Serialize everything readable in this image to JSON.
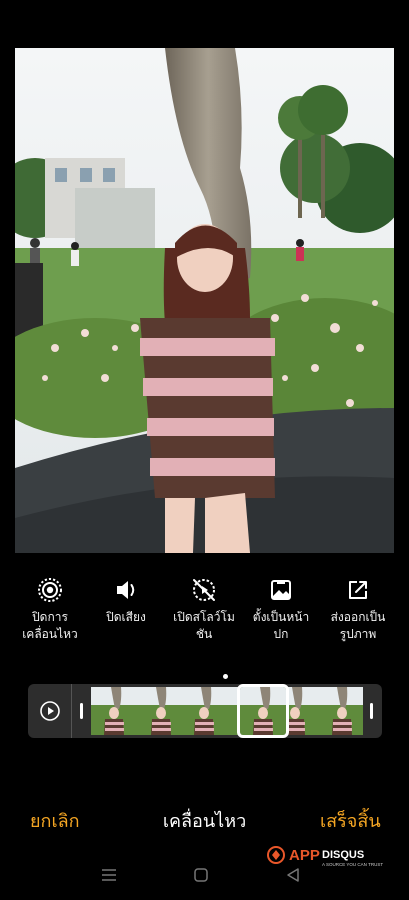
{
  "toolbar": {
    "items": [
      {
        "label": "ปิดการ\nเคลื่อนไหว",
        "icon": "motion-photo-icon"
      },
      {
        "label": "ปิดเสียง",
        "icon": "speaker-icon"
      },
      {
        "label": "เปิดสโลว์โม\nชัน",
        "icon": "slow-motion-off-icon"
      },
      {
        "label": "ตั้งเป็นหน้า\nปก",
        "icon": "cover-image-icon"
      },
      {
        "label": "ส่งออกเป็น\nรูปภาพ",
        "icon": "export-icon"
      }
    ]
  },
  "filmstrip": {
    "play_icon": "play-motion-icon",
    "frame_count": 6,
    "selected_frame": 4
  },
  "bottom_bar": {
    "cancel_label": "ยกเลิก",
    "title": "เคลื่อนไหว",
    "done_label": "เสร็จสิ้น"
  },
  "nav": {
    "menu_icon": "menu-icon",
    "home_icon": "home-icon",
    "back_icon": "back-icon"
  },
  "watermark": {
    "brand": "APPDISQUS",
    "tagline": "A SOURCE YOU CAN TRUST"
  },
  "colors": {
    "accent": "#f5a623",
    "background": "#000000",
    "strip": "#2d2d2d"
  }
}
